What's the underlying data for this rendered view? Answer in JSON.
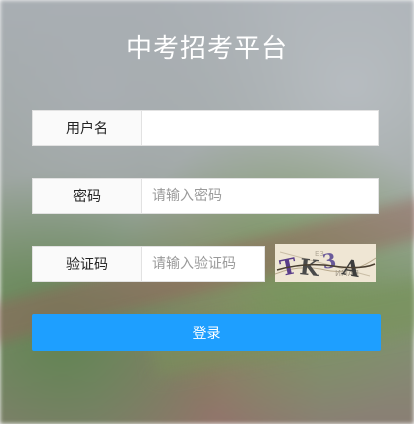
{
  "page": {
    "title": "中考招考平台"
  },
  "form": {
    "username": {
      "label": "用户名",
      "value": "",
      "placeholder": ""
    },
    "password": {
      "label": "密码",
      "value": "",
      "placeholder": "请输入密码"
    },
    "captcha": {
      "label": "验证码",
      "value": "",
      "placeholder": "请输入验证码",
      "image_text": "TK3A"
    },
    "submit_label": "登录"
  },
  "colors": {
    "primary_button": "#1e9fff",
    "title_text": "#ffffff"
  }
}
